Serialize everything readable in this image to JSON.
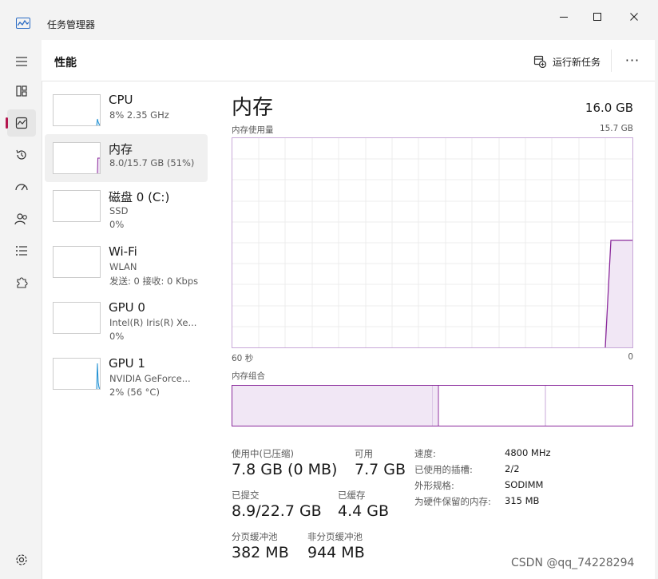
{
  "window": {
    "title": "任务管理器"
  },
  "header": {
    "title": "性能",
    "run_task_label": "运行新任务",
    "more_label": "···"
  },
  "devices": [
    {
      "name": "CPU",
      "line1": "8% 2.35 GHz",
      "line2": ""
    },
    {
      "name": "内存",
      "line1": "8.0/15.7 GB (51%)",
      "line2": ""
    },
    {
      "name": "磁盘 0 (C:)",
      "line1": "SSD",
      "line2": "0%"
    },
    {
      "name": "Wi-Fi",
      "line1": "WLAN",
      "line2": "发送: 0 接收: 0 Kbps"
    },
    {
      "name": "GPU 0",
      "line1": "Intel(R) Iris(R) Xe...",
      "line2": "0%"
    },
    {
      "name": "GPU 1",
      "line1": "NVIDIA GeForce...",
      "line2": "2% (56 °C)"
    }
  ],
  "memory": {
    "title": "内存",
    "total": "16.0 GB",
    "usage_label": "内存使用量",
    "usage_max": "15.7 GB",
    "time_left": "60 秒",
    "time_right": "0",
    "composition_label": "内存组合",
    "stats": {
      "in_use_label": "使用中(已压缩)",
      "in_use_value": "7.8 GB (0 MB)",
      "available_label": "可用",
      "available_value": "7.7 GB",
      "committed_label": "已提交",
      "committed_value": "8.9/22.7 GB",
      "cached_label": "已缓存",
      "cached_value": "4.4 GB",
      "paged_label": "分页缓冲池",
      "paged_value": "382 MB",
      "nonpaged_label": "非分页缓冲池",
      "nonpaged_value": "944 MB"
    },
    "props": [
      {
        "label": "速度:",
        "value": "4800 MHz"
      },
      {
        "label": "已使用的插槽:",
        "value": "2/2"
      },
      {
        "label": "外形规格:",
        "value": "SODIMM"
      },
      {
        "label": "为硬件保留的内存:",
        "value": "315 MB"
      }
    ]
  },
  "watermark": "CSDN @qq_74228294",
  "colors": {
    "accent_memory": "#8b2a9c",
    "accent_cpu": "#1e8fd2",
    "active_indicator": "#b4164e"
  }
}
